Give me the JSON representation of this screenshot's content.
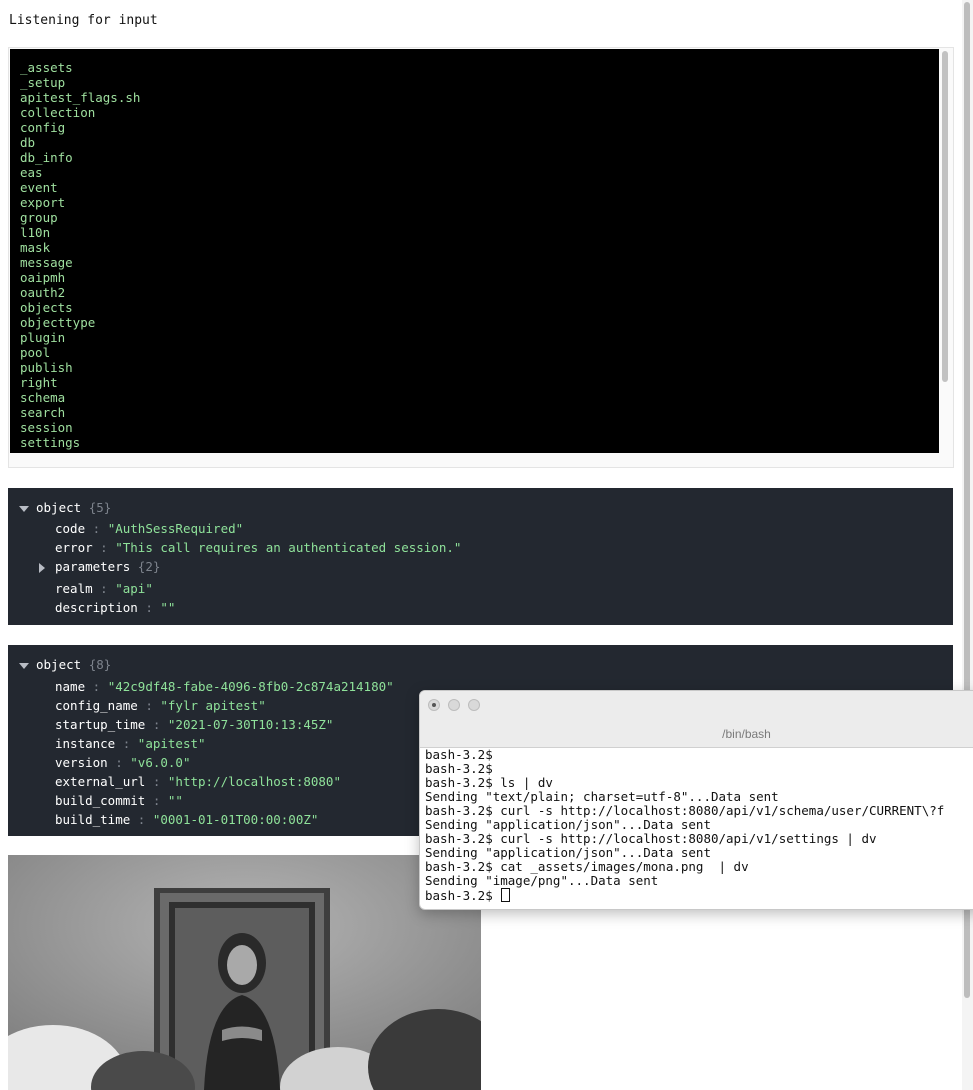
{
  "status_text": "Listening for input",
  "text_output": {
    "lines": [
      "_assets",
      "_setup",
      "apitest_flags.sh",
      "collection",
      "config",
      "db",
      "db_info",
      "eas",
      "event",
      "export",
      "group",
      "l10n",
      "mask",
      "message",
      "oaipmh",
      "oauth2",
      "objects",
      "objecttype",
      "plugin",
      "pool",
      "publish",
      "right",
      "schema",
      "search",
      "session",
      "settings"
    ]
  },
  "json_blocks": [
    {
      "root_label": "object",
      "count": "{5}",
      "rows": [
        {
          "key": "code",
          "value": "\"AuthSessRequired\""
        },
        {
          "key": "error",
          "value": "\"This call requires an authenticated session.\""
        },
        {
          "key": "parameters",
          "value": "{2}",
          "collapsed": true
        },
        {
          "key": "realm",
          "value": "\"api\""
        },
        {
          "key": "description",
          "value": "\"\""
        }
      ]
    },
    {
      "root_label": "object",
      "count": "{8}",
      "rows": [
        {
          "key": "name",
          "value": "\"42c9df48-fabe-4096-8fb0-2c874a214180\""
        },
        {
          "key": "config_name",
          "value": "\"fylr apitest\""
        },
        {
          "key": "startup_time",
          "value": "\"2021-07-30T10:13:45Z\""
        },
        {
          "key": "instance",
          "value": "\"apitest\""
        },
        {
          "key": "version",
          "value": "\"v6.0.0\""
        },
        {
          "key": "external_url",
          "value": "\"http://localhost:8080\""
        },
        {
          "key": "build_commit",
          "value": "\"\""
        },
        {
          "key": "build_time",
          "value": "\"0001-01-01T00:00:00Z\""
        }
      ]
    }
  ],
  "terminal": {
    "title": "/bin/bash",
    "lines": [
      "bash-3.2$",
      "bash-3.2$",
      "bash-3.2$ ls | dv",
      "Sending \"text/plain; charset=utf-8\"...Data sent",
      "bash-3.2$ curl -s http://localhost:8080/api/v1/schema/user/CURRENT\\?f",
      "Sending \"application/json\"...Data sent",
      "bash-3.2$ curl -s http://localhost:8080/api/v1/settings | dv",
      "Sending \"application/json\"...Data sent",
      "bash-3.2$ cat _assets/images/mona.png  | dv",
      "Sending \"image/png\"...Data sent",
      "bash-3.2$ "
    ]
  },
  "icons": {
    "expand": "caret-down-icon",
    "collapse": "caret-right-icon",
    "window_close": "close-window-icon"
  },
  "colors": {
    "text_block_bg": "#000000",
    "text_green": "#9fe09f",
    "json_bg": "#232830",
    "json_string": "#8fe29a",
    "json_muted": "#7d838c"
  }
}
